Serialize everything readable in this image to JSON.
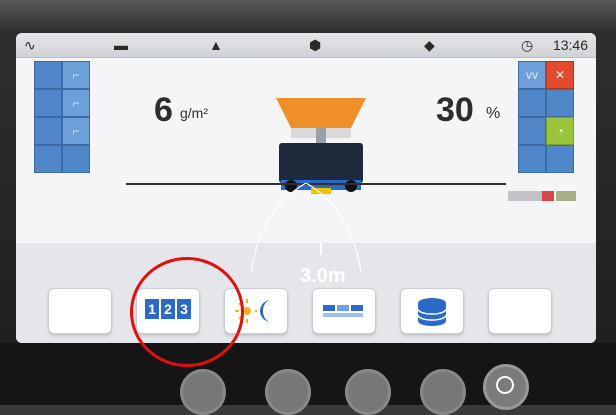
{
  "statusbar": {
    "clock_icon": "clock-icon",
    "time": "13:46",
    "icons": [
      "heating-icon",
      "road-icon",
      "bridge-icon",
      "dot-icon",
      "drop-icon"
    ]
  },
  "left_panel": {
    "value": "6",
    "unit": "g/m²"
  },
  "right_panel": {
    "value": "30",
    "unit": "%"
  },
  "distance": "3.0m",
  "softkeys": [
    {
      "name": "blank-softkey-1"
    },
    {
      "name": "counter-softkey",
      "label": "1 2 3"
    },
    {
      "name": "day-night-softkey"
    },
    {
      "name": "width-softkey"
    },
    {
      "name": "database-softkey"
    },
    {
      "name": "blank-softkey-2"
    }
  ],
  "colors": {
    "cell_blue": "#4f87c8",
    "accent_red": "#e01010",
    "truck_orange": "#f0902b"
  },
  "annotation_circle": {
    "color": "#e01010"
  }
}
